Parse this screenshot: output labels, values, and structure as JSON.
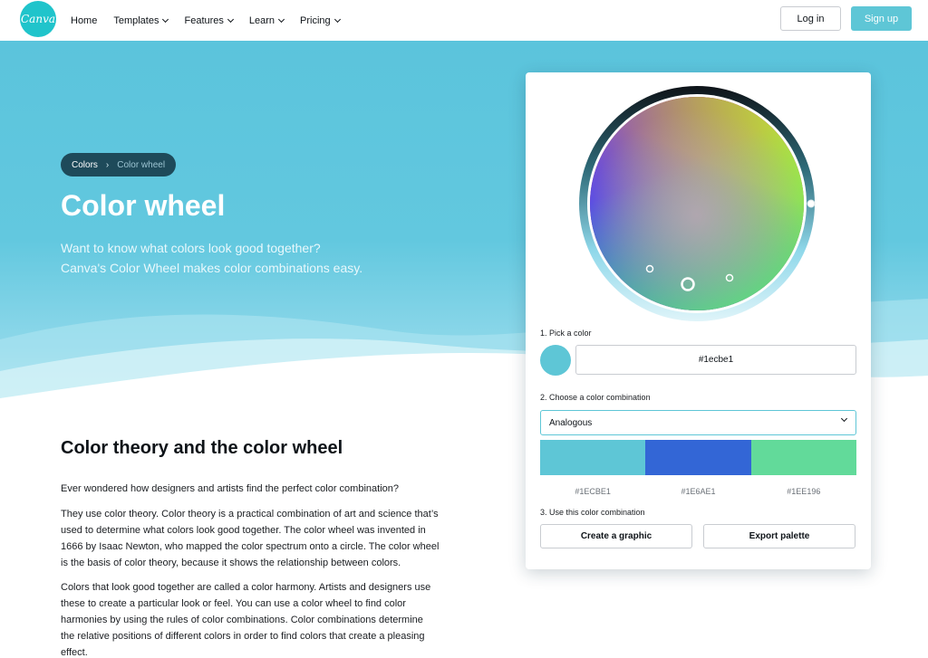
{
  "nav": {
    "logo_text": "Canva",
    "links": [
      {
        "label": "Home",
        "dropdown": false
      },
      {
        "label": "Templates",
        "dropdown": true
      },
      {
        "label": "Features",
        "dropdown": true
      },
      {
        "label": "Learn",
        "dropdown": true
      },
      {
        "label": "Pricing",
        "dropdown": true
      }
    ],
    "login_label": "Log in",
    "signup_label": "Sign up"
  },
  "hero": {
    "breadcrumb": [
      "Colors",
      "Color wheel"
    ],
    "title": "Color wheel",
    "subtitle_line1": "Want to know what colors look good together?",
    "subtitle_line2": "Canva's Color Wheel makes color combinations easy."
  },
  "content": {
    "section_title": "Color theory and the color wheel",
    "paragraphs": [
      [
        "Ever wondered how designers and artists find the perfect color combination?"
      ],
      [
        "They use color theory. Color theory is a practical combination of art and science that’s",
        "used to determine what colors look good together. The color wheel was invented in",
        "1666 by Isaac Newton, who mapped the color spectrum onto a circle. The color wheel",
        "is the basis of color theory, because it shows the relationship between colors."
      ],
      [
        "Colors that look good together are called a color harmony. Artists and designers use",
        "these to create a particular look or feel. You can use a color wheel to find color",
        "harmonies by using the rules of color combinations. Color combinations determine",
        "the relative positions of different colors in order to find colors that create a pleasing",
        "effect."
      ]
    ]
  },
  "tool": {
    "step1_label": "1. Pick a color",
    "selected_color": "#5ec6d6",
    "hex_value": "#1ecbe1",
    "step2_label": "2. Choose a color combination",
    "combination": "Analogous",
    "palette": [
      {
        "hex": "#1ECBE1",
        "display": "#5ec6d6"
      },
      {
        "hex": "#1E6AE1",
        "display": "#3366d6"
      },
      {
        "hex": "#1EE196",
        "display": "#62da9a"
      }
    ],
    "step3_label": "3. Use this color combination",
    "create_label": "Create a graphic",
    "export_label": "Export palette"
  }
}
